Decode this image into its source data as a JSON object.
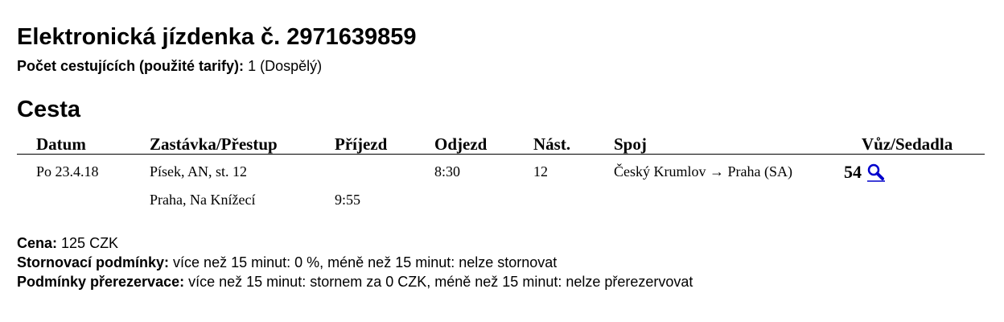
{
  "ticket": {
    "title": "Elektronická jízdenka č. 2971639859",
    "passengers_label": "Počet cestujících (použité tarify):",
    "passengers_value": "1 (Dospělý)"
  },
  "journey": {
    "section_title": "Cesta",
    "columns": {
      "date": "Datum",
      "stop": "Zastávka/Přestup",
      "arrival": "Příjezd",
      "departure": "Odjezd",
      "platform": "Nást.",
      "connection": "Spoj",
      "car_seats": "Vůz/Sedadla"
    },
    "rows": [
      {
        "date": "Po 23.4.18",
        "stop": "Písek, AN, st. 12",
        "arrival": "",
        "departure": "8:30",
        "platform": "12",
        "connection": "Český Krumlov → Praha (SA)",
        "seat": "54"
      },
      {
        "date": "",
        "stop": "Praha, Na Knížecí",
        "arrival": "9:55",
        "departure": "",
        "platform": "",
        "connection": "",
        "seat": ""
      }
    ],
    "seat_link_icon": "magnifier-icon",
    "link_color": "#0000cc"
  },
  "info": {
    "price_label": "Cena:",
    "price_value": "125 CZK",
    "cancellation_label": "Stornovací podmínky:",
    "cancellation_value": "více než 15 minut: 0 %, méně než 15 minut: nelze stornovat",
    "rebooking_label": "Podmínky přerezervace:",
    "rebooking_value": "více než 15 minut: stornem za 0 CZK, méně než 15 minut: nelze přerezervovat"
  }
}
